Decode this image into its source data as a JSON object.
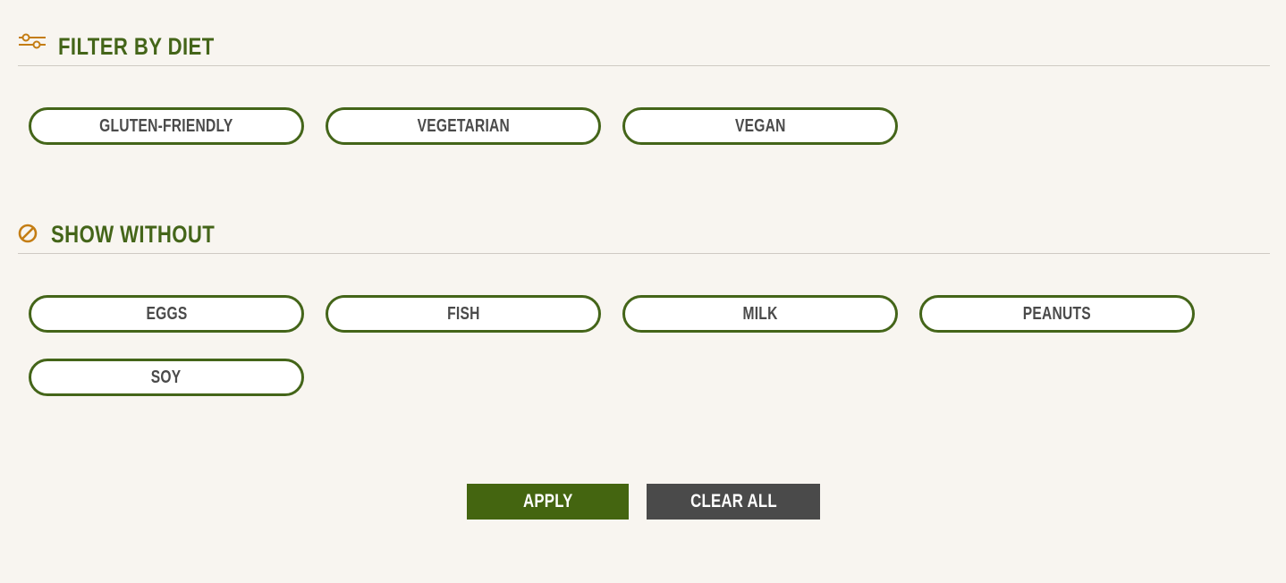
{
  "diet": {
    "title": "FILTER BY DIET",
    "icon": "sliders-icon",
    "options": [
      {
        "label": "GLUTEN-FRIENDLY"
      },
      {
        "label": "VEGETARIAN"
      },
      {
        "label": "VEGAN"
      }
    ]
  },
  "without": {
    "title": "SHOW WITHOUT",
    "icon": "prohibited-icon",
    "options": [
      {
        "label": "EGGS"
      },
      {
        "label": "FISH"
      },
      {
        "label": "MILK"
      },
      {
        "label": "PEANUTS"
      },
      {
        "label": "SOY"
      }
    ]
  },
  "actions": {
    "apply_label": "APPLY",
    "clear_label": "CLEAR ALL"
  },
  "colors": {
    "background": "#f8f5f0",
    "accent_green": "#446519",
    "icon_orange": "#c47d14",
    "clear_gray": "#4a4a4a"
  }
}
